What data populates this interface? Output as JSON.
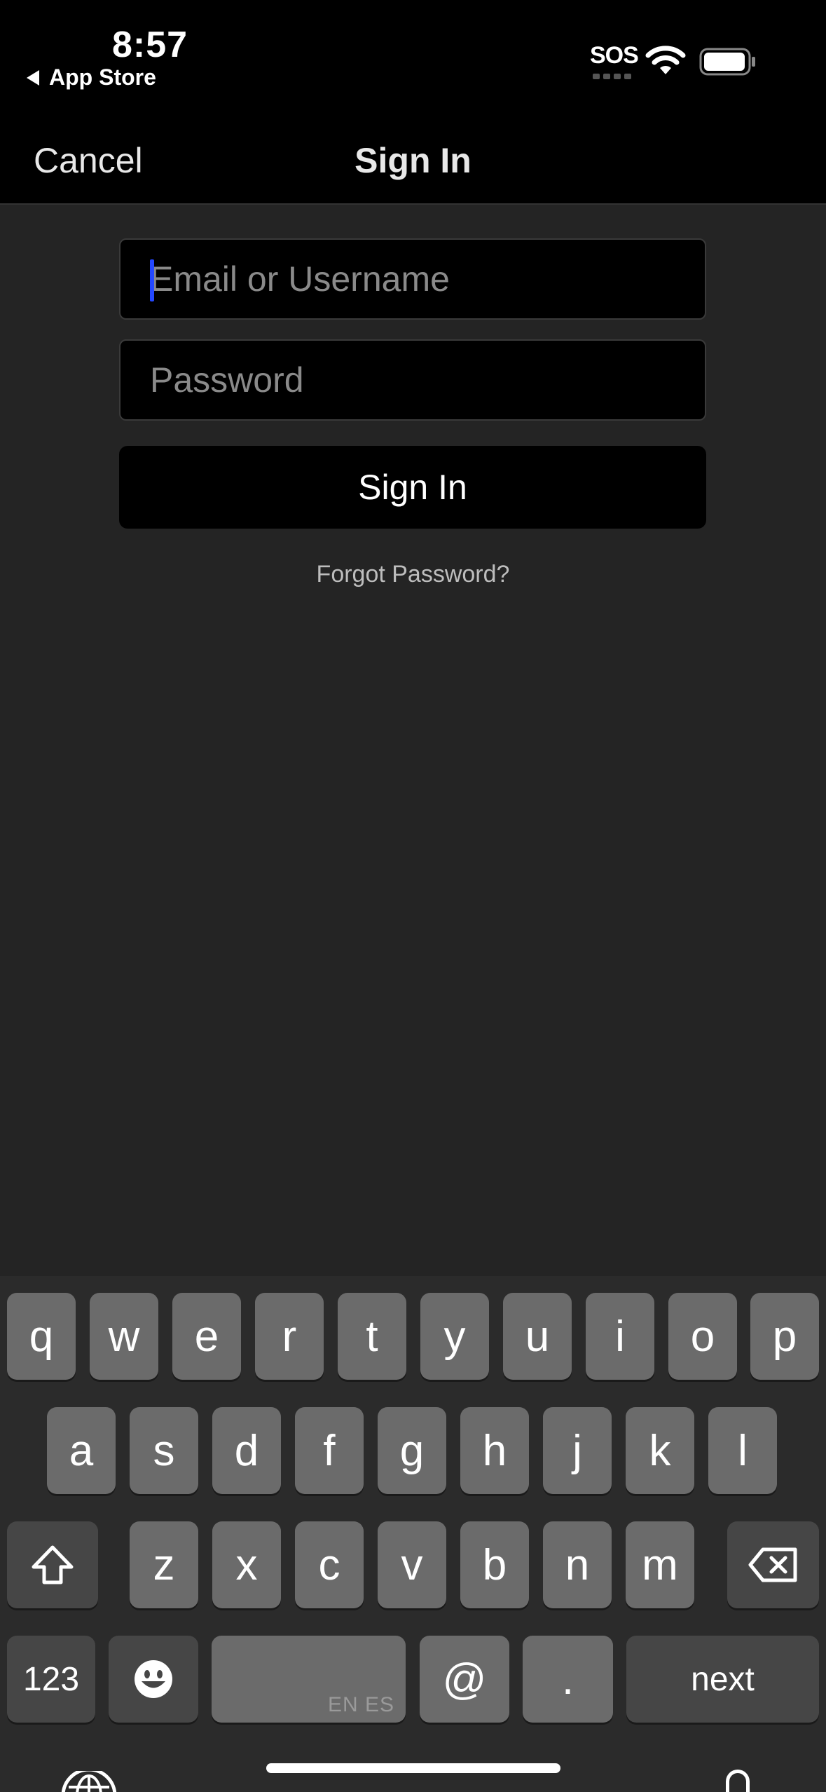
{
  "status_bar": {
    "time": "8:57",
    "back_app": "App Store",
    "carrier": "SOS",
    "icons": [
      "wifi-icon",
      "battery-icon"
    ]
  },
  "nav": {
    "cancel_label": "Cancel",
    "title": "Sign In"
  },
  "form": {
    "email_placeholder": "Email or Username",
    "email_value": "",
    "password_placeholder": "Password",
    "password_value": "",
    "signin_label": "Sign In",
    "forgot_label": "Forgot Password?"
  },
  "keyboard": {
    "row1": [
      "q",
      "w",
      "e",
      "r",
      "t",
      "y",
      "u",
      "i",
      "o",
      "p"
    ],
    "row2": [
      "a",
      "s",
      "d",
      "f",
      "g",
      "h",
      "j",
      "k",
      "l"
    ],
    "row3": [
      "z",
      "x",
      "c",
      "v",
      "b",
      "n",
      "m"
    ],
    "numbers_label": "123",
    "space_sublabel": "EN ES",
    "at_label": "@",
    "dot_label": ".",
    "next_label": "next",
    "icons": [
      "shift-icon",
      "backspace-icon",
      "emoji-icon",
      "globe-icon",
      "microphone-icon"
    ]
  },
  "colors": {
    "background": "#242424",
    "bar": "#000000",
    "caret": "#2448ff",
    "key": "#6b6b6b",
    "key_dark": "#464646"
  }
}
